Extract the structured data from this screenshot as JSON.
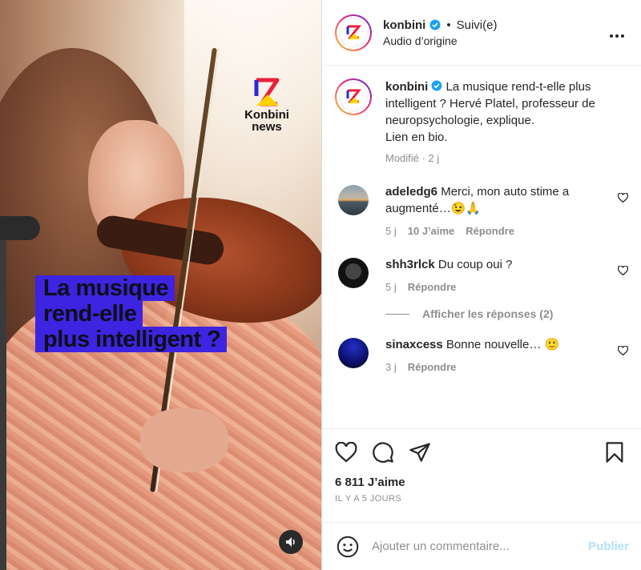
{
  "colors": {
    "accent": "#0095f6",
    "publish_disabled": "#b2dffc",
    "headline_bg": "#3d24e0",
    "verified": "#1da1f2"
  },
  "media": {
    "logo_line1": "Konbini",
    "logo_line2": "news",
    "headline_lines": [
      "La musique",
      "rend-elle",
      "plus intelligent ?"
    ],
    "sound_icon": "speaker-icon"
  },
  "header": {
    "username": "konbini",
    "separator": "•",
    "follow_status": "Suivi(e)",
    "subtitle": "Audio d’origine",
    "more_label": "•••"
  },
  "caption": {
    "username": "konbini",
    "text": " La musique rend-t-elle plus intelligent ? Hervé Platel, professeur de neuropsychologie, explique.",
    "line2": "Lien en bio.",
    "meta": "Modifié · 2 j"
  },
  "comments": [
    {
      "username": "adeledg6",
      "text": " Merci, mon auto stime a augmenté…😉🙏",
      "time": "5 j",
      "likes": "10 J’aime",
      "reply": "Répondre"
    },
    {
      "username": "shh3rlck",
      "text": " Du coup oui ?",
      "time": "5 j",
      "reply": "Répondre"
    },
    {
      "username": "sinaxcess",
      "text": " Bonne nouvelle… 🙂",
      "time": "3 j",
      "reply": "Répondre"
    }
  ],
  "view_replies": "Afficher les réponses (2)",
  "likes_count": "6 811 J’aime",
  "posted_ago": "IL Y A 5 JOURS",
  "add_comment": {
    "placeholder": "Ajouter un commentaire...",
    "publish_label": "Publier"
  }
}
